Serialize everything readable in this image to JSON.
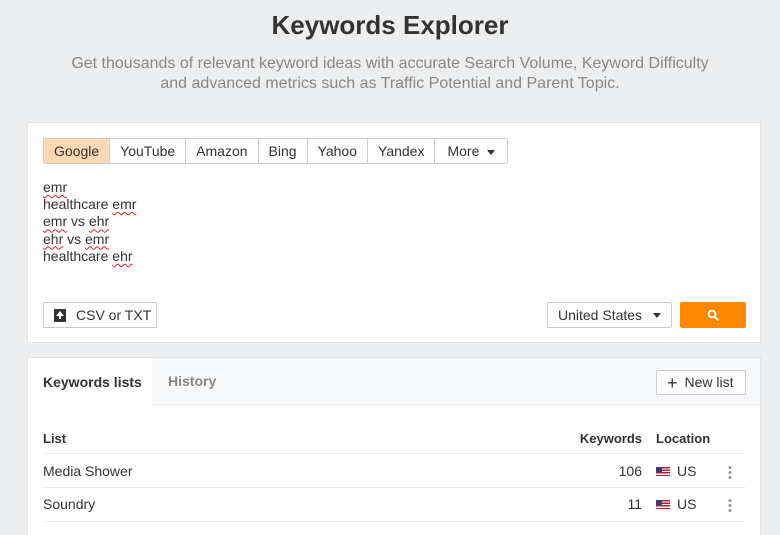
{
  "header": {
    "title": "Keywords Explorer",
    "subtitle": "Get thousands of relevant keyword ideas with accurate Search Volume, Keyword Difficulty and advanced metrics such as Traffic Potential and Parent Topic."
  },
  "search": {
    "engines": [
      {
        "label": "Google",
        "active": true
      },
      {
        "label": "YouTube",
        "active": false
      },
      {
        "label": "Amazon",
        "active": false
      },
      {
        "label": "Bing",
        "active": false
      },
      {
        "label": "Yahoo",
        "active": false
      },
      {
        "label": "Yandex",
        "active": false
      }
    ],
    "more_label": "More",
    "keywords": [
      "emr",
      "healthcare emr",
      "emr vs ehr",
      "ehr vs emr",
      "healthcare ehr"
    ],
    "upload_label": "CSV or TXT",
    "country": "United States",
    "colors": {
      "accent": "#ff8800",
      "active_tab": "#fcd9b4"
    },
    "icons": {
      "upload": "upload-icon",
      "search": "search-icon"
    }
  },
  "lists": {
    "tabs": {
      "lists": "Keywords lists",
      "history": "History"
    },
    "new_list_label": "New list",
    "columns": {
      "list": "List",
      "keywords": "Keywords",
      "location": "Location"
    },
    "rows": [
      {
        "name": "Media Shower",
        "keywords": "106",
        "location": "US"
      },
      {
        "name": "Soundry",
        "keywords": "11",
        "location": "US"
      }
    ]
  }
}
